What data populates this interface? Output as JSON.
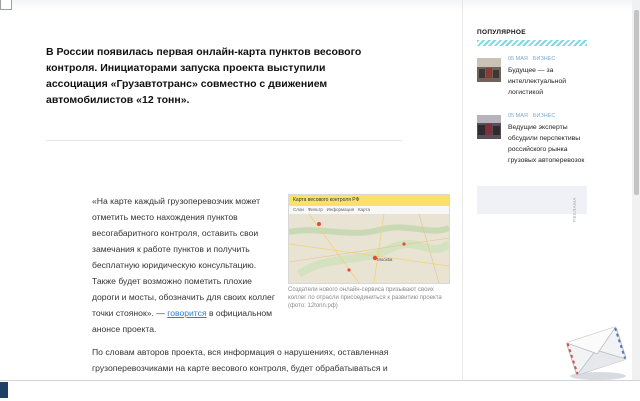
{
  "article": {
    "lead": "В России появилась первая онлайн-карта пунктов весового контроля. Инициаторами запуска проекта выступили ассоциация «Грузавтотранс» совместно с движением автомобилистов «12 тонн».",
    "quote_before_link": "«На карте каждый грузоперевозчик может отметить место нахождения пунктов весогабаритного контроля, оставить свои замечания к работе пунктов и получить бесплатную юридическую консультацию. Также будет возможно пометить плохие дороги и мосты, обозначить для своих коллег точки стоянок». — ",
    "quote_link": "говорится",
    "quote_after_link": " в официальном анонсе проекта.",
    "body_paragraph": "По словам авторов проекта, вся информация о нарушениях, оставленная грузоперевозчиками на карте весового контроля, будет обрабатываться и направляться «в соответствующие структуры»."
  },
  "figure": {
    "header_text": "Карта весового контроля РФ",
    "toolbar_items": [
      "Слои",
      "Фильтр",
      "Информация",
      "Карта"
    ],
    "caption": "Создатели нового онлайн-сервиса призывают своих коллег по отрасли присоединиться к развитию проекта (фото: 12tonn.рф)",
    "city_label": "Москва"
  },
  "sidebar": {
    "popular_title": "ПОПУЛЯРНОЕ",
    "items": [
      {
        "date": "05 МАЯ",
        "category": "БИЗНЕС",
        "title": "Будущее — за интеллектуальной логистикой"
      },
      {
        "date": "05 МАЯ",
        "category": "БИЗНЕС",
        "title": "Ведущие эксперты обсудили перспективы российского рынка грузовых автоперевозок"
      }
    ],
    "ad_label": "РЕКЛАМА"
  },
  "colors": {
    "link": "#2f7fcf",
    "meta": "#7aaad0",
    "accent_strip": "#7fd9e1",
    "map_header": "#fbe06b"
  },
  "icons": {
    "envelope": "envelope-icon"
  }
}
